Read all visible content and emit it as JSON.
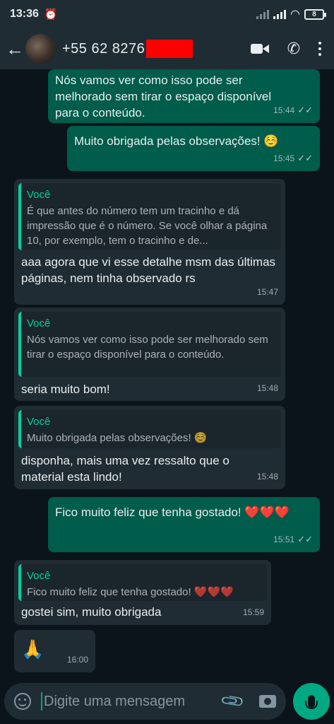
{
  "status_bar": {
    "time": "13:36",
    "battery": "8"
  },
  "header": {
    "contact": "+55 62 8276",
    "icons": [
      "back-arrow-icon",
      "video-call-icon",
      "phone-icon",
      "more-options-icon"
    ]
  },
  "messages": [
    {
      "dir": "out",
      "text": "Nós vamos ver como isso pode ser melhorado sem tirar o espaço disponível para o conteúdo.",
      "time": "15:44"
    },
    {
      "dir": "out",
      "text": "Muito obrigada pelas observações! ☺️",
      "time": "15:45"
    },
    {
      "dir": "in",
      "quote_name": "Você",
      "quote_text": "É que antes do número tem um tracinho e dá impressão que é o número. Se você olhar a página 10, por exemplo, tem o tracinho e de...",
      "text": "aaa agora que vi esse detalhe msm das últimas páginas, nem tinha observado rs",
      "time": "15:47"
    },
    {
      "dir": "in",
      "quote_name": "Você",
      "quote_text": "Nós vamos ver como isso pode ser melhorado sem tirar o espaço disponível para o conteúdo.",
      "text": "seria muito bom!",
      "time": "15:48"
    },
    {
      "dir": "in",
      "quote_name": "Você",
      "quote_text": "Muito obrigada pelas observações! ☺️",
      "text": "disponha, mais uma vez ressalto que o material esta lindo!",
      "time": "15:48"
    },
    {
      "dir": "out",
      "text": "Fico muito feliz que tenha gostado! ❤️❤️❤️",
      "time": "15:51"
    },
    {
      "dir": "in",
      "quote_name": "Você",
      "quote_text": "Fico muito feliz que tenha gostado! ❤️❤️❤️",
      "text": "gostei sim, muito obrigada",
      "time": "15:59"
    },
    {
      "dir": "in",
      "text": "🙏",
      "time": "16:00"
    }
  ],
  "input": {
    "placeholder": "Digite uma mensagem"
  },
  "colors": {
    "outgoing": "#005c4b",
    "incoming": "#202c33",
    "accent": "#00a884"
  }
}
